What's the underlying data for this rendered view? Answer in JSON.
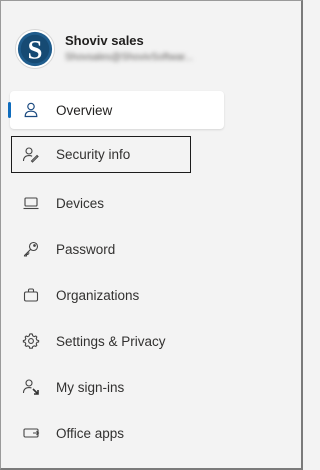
{
  "profile": {
    "name": "Shoviv sales",
    "email": "Shovsales@ShovivSoftwar..."
  },
  "nav": {
    "items": [
      {
        "label": "Overview",
        "icon": "person-icon"
      },
      {
        "label": "Security info",
        "icon": "person-key-icon"
      },
      {
        "label": "Devices",
        "icon": "laptop-icon"
      },
      {
        "label": "Password",
        "icon": "key-icon"
      },
      {
        "label": "Organizations",
        "icon": "briefcase-icon"
      },
      {
        "label": "Settings & Privacy",
        "icon": "gear-icon"
      },
      {
        "label": "My sign-ins",
        "icon": "person-sign-in-icon"
      },
      {
        "label": "Office apps",
        "icon": "apps-icon"
      }
    ]
  },
  "colors": {
    "accent": "#0f6cbd",
    "background": "#f3f3f3",
    "active_background": "#ffffff",
    "text": "#323130"
  }
}
